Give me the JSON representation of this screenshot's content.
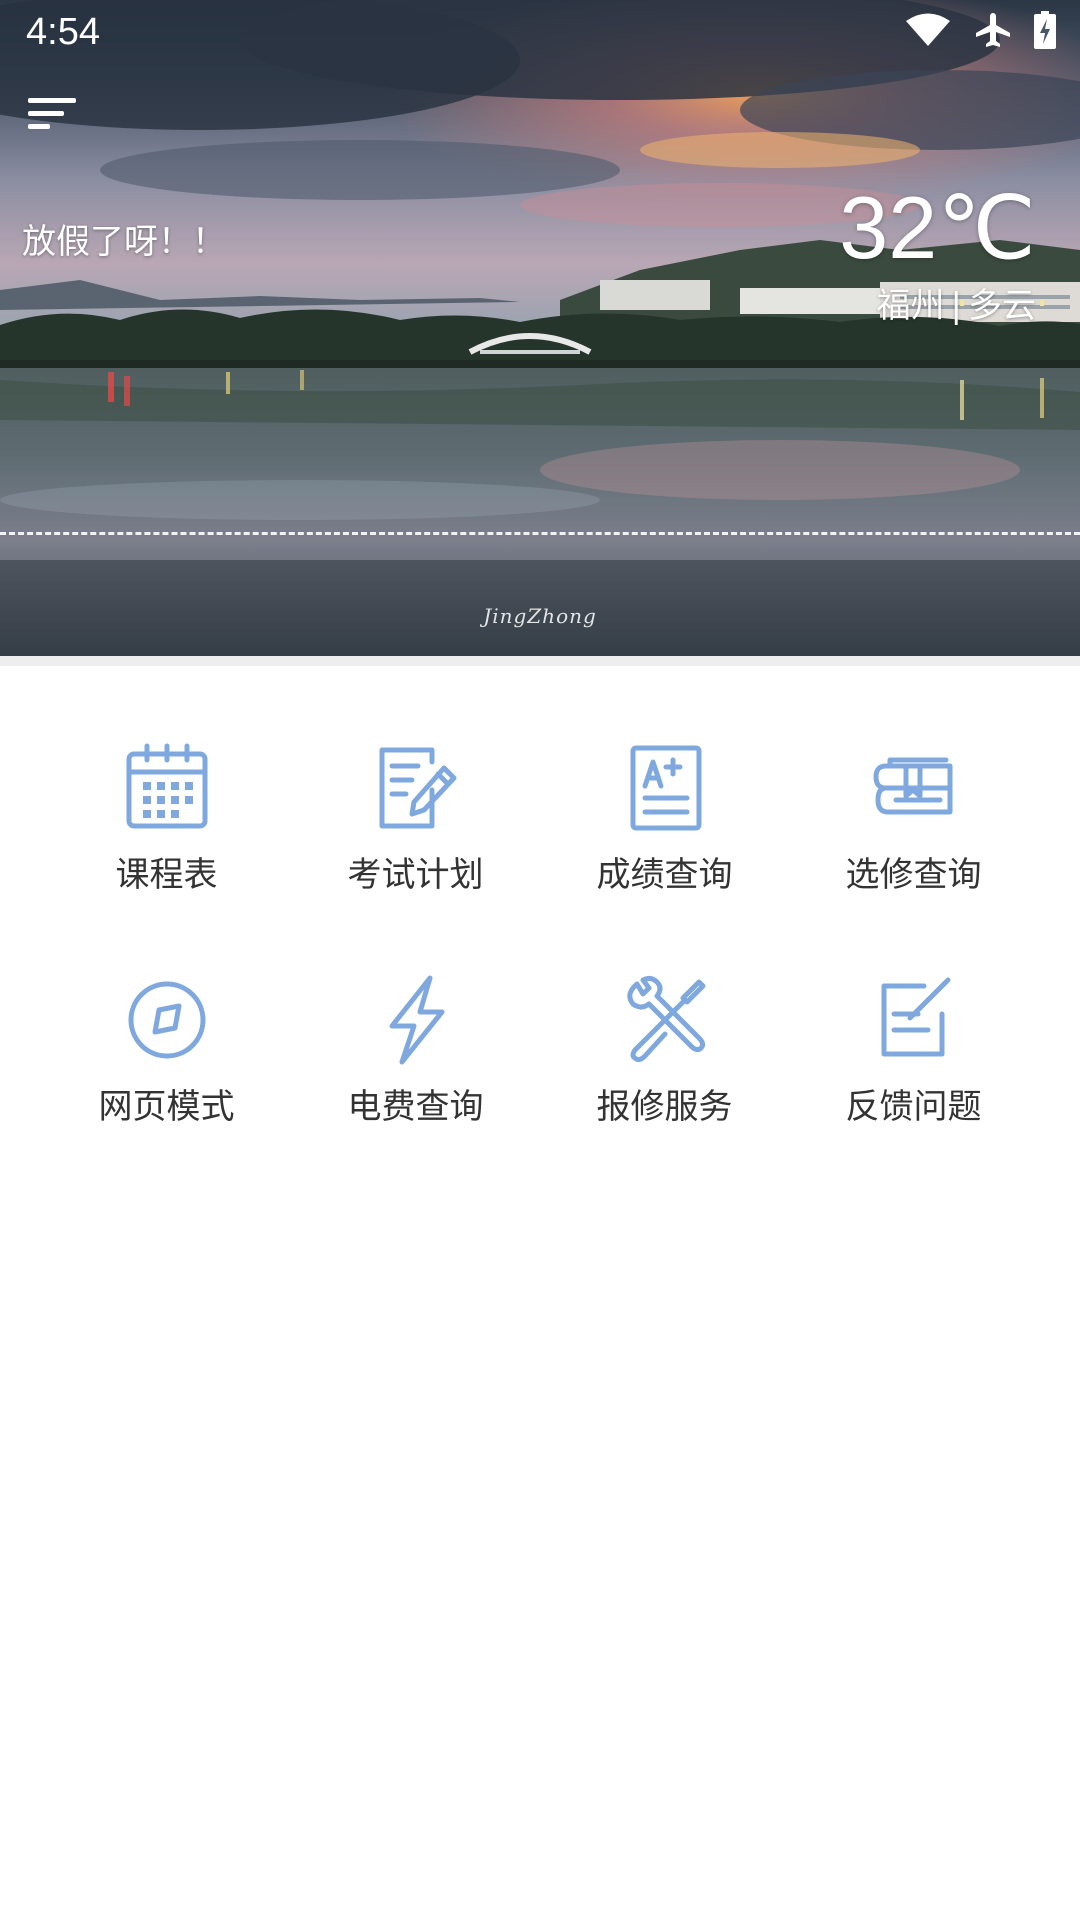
{
  "status_bar": {
    "time": "4:54",
    "icons": [
      "wifi-icon",
      "airplane-mode-icon",
      "battery-charging-icon"
    ]
  },
  "header": {
    "menu_icon": "menu-icon",
    "greeting": "放假了呀！！",
    "temperature": "32℃",
    "city": "福州",
    "separator": "|",
    "weather": "多云",
    "signature": "JingZhong"
  },
  "colors": {
    "accent": "#7FA8DF",
    "label": "#333333",
    "divider": "#EEEEEE"
  },
  "features": [
    {
      "label": "课程表",
      "icon": "calendar-icon"
    },
    {
      "label": "考试计划",
      "icon": "exam-edit-icon"
    },
    {
      "label": "成绩查询",
      "icon": "grade-document-icon"
    },
    {
      "label": "选修查询",
      "icon": "books-icon"
    },
    {
      "label": "网页模式",
      "icon": "compass-icon"
    },
    {
      "label": "电费查询",
      "icon": "lightning-icon"
    },
    {
      "label": "报修服务",
      "icon": "tools-icon"
    },
    {
      "label": "反馈问题",
      "icon": "feedback-edit-icon"
    }
  ]
}
